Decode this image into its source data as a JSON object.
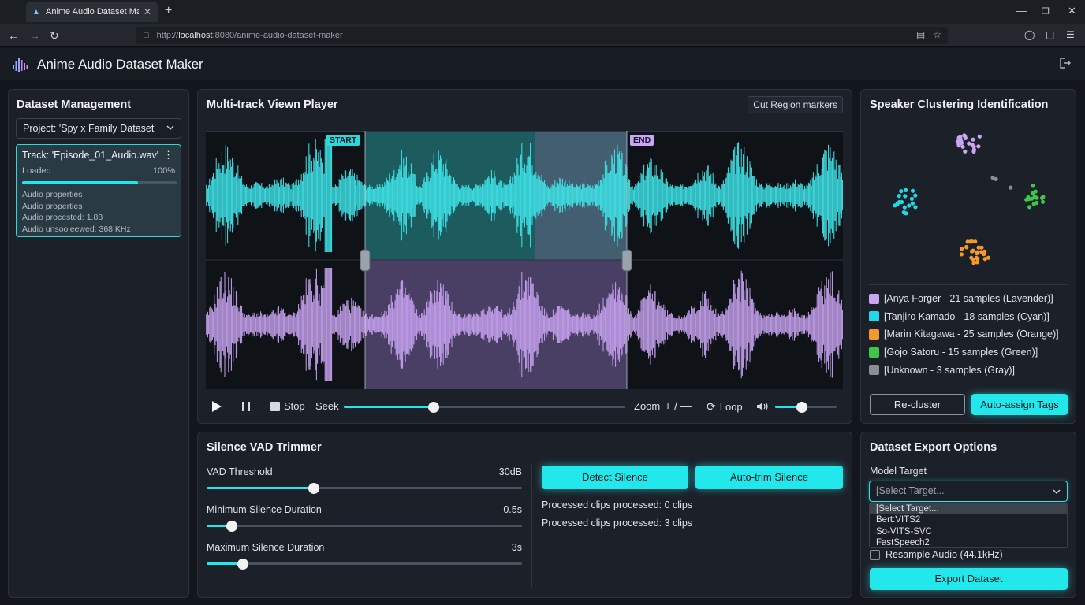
{
  "browser": {
    "tab_title": "Anime Audio Dataset Maker",
    "url_prefix": "http://",
    "url_host": "localhost",
    "url_rest": ":8080/anime-audio-dataset-maker"
  },
  "app": {
    "title": "Anime Audio Dataset Maker"
  },
  "dataset": {
    "title": "Dataset Management",
    "project": "Project: 'Spy x Family Dataset'",
    "track": {
      "name": "Track: 'Episode_01_Audio.wav'",
      "status": "Loaded",
      "progress_label": "100%",
      "progress": 0.75,
      "props": [
        "Audio properties",
        "Audio properties",
        "Audio procested: 1.88",
        "Audio unsooleewed: 368 KHz"
      ]
    }
  },
  "player": {
    "title": "Multi-track Viewn Player",
    "cut_label": "Cut Region markers",
    "start_label": "START",
    "end_label": "END",
    "stop_label": "Stop",
    "seek_label": "Seek",
    "zoom_label": "Zoom",
    "zoom_controls": "+ / —",
    "loop_label": "Loop",
    "seek_value": 0.32,
    "volume_value": 0.43
  },
  "speakers": {
    "title": "Speaker Clustering Identification",
    "items": [
      {
        "label": "[Anya Forger - 21 samples (Lavender)]",
        "color": "#c9a6f2"
      },
      {
        "label": "[Tanjiro Kamado - 18 samples (Cyan)]",
        "color": "#22d8e6"
      },
      {
        "label": "[Marin Kitagawa - 25 samples (Orange)]",
        "color": "#f39a2a"
      },
      {
        "label": "[Gojo Satoru - 15 samples (Green)]",
        "color": "#3fc64a"
      },
      {
        "label": "[Unknown - 3 samples (Gray)]",
        "color": "#8a8d92"
      }
    ],
    "recluster_label": "Re-cluster",
    "autoassign_label": "Auto-assign Tags"
  },
  "vad": {
    "title": "Silence VAD Trimmer",
    "rows": [
      {
        "label": "VAD Threshold",
        "value": "30dB",
        "level": 0.34
      },
      {
        "label": "Minimum Silence Duration",
        "value": "0.5s",
        "level": 0.08
      },
      {
        "label": "Maximum Silence Duration",
        "value": "3s",
        "level": 0.115
      }
    ],
    "detect_label": "Detect Silence",
    "autotrim_label": "Auto-trim Silence",
    "processed": [
      "Processed clips processed: 0 clips",
      "Processed clips processed: 3 clips"
    ]
  },
  "export": {
    "title": "Dataset Export Options",
    "model_label": "Model Target",
    "placeholder": "[Select Target...",
    "options": [
      "[Select Target...",
      "Bert:VITS2",
      "So-VITS-SVC",
      "FastSpeech2"
    ],
    "resample_label": "Resample Audio (44.1kHz)",
    "export_label": "Export Dataset"
  }
}
